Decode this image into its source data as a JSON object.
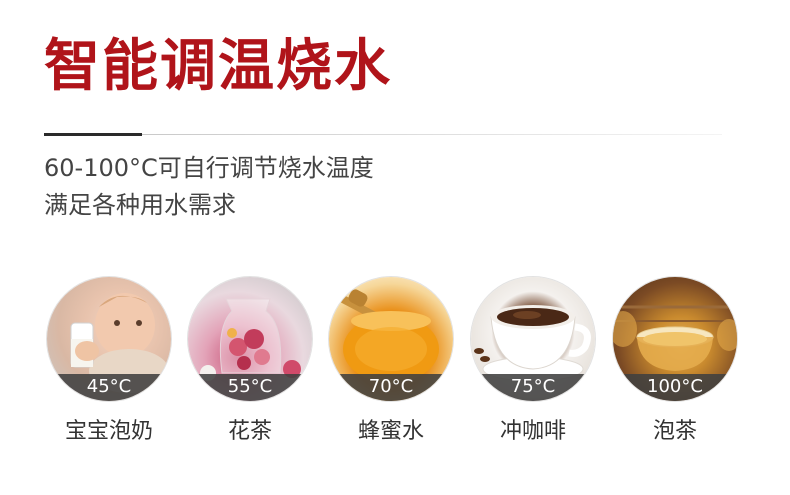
{
  "header": {
    "title": "智能调温烧水",
    "subtitle_line1": "60-100°C可自行调节烧水温度",
    "subtitle_line2": "满足各种用水需求"
  },
  "items": [
    {
      "temp": "45°C",
      "label": "宝宝泡奶",
      "icon": "baby-drinking-milk"
    },
    {
      "temp": "55°C",
      "label": "花茶",
      "icon": "flower-tea-pitcher"
    },
    {
      "temp": "70°C",
      "label": "蜂蜜水",
      "icon": "honey-jar"
    },
    {
      "temp": "75°C",
      "label": "冲咖啡",
      "icon": "coffee-cup"
    },
    {
      "temp": "100°C",
      "label": "泡茶",
      "icon": "tea-cups"
    }
  ]
}
